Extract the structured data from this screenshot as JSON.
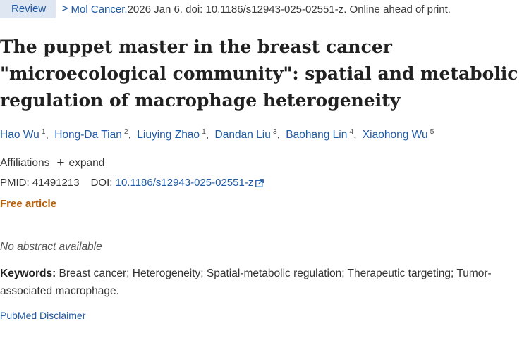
{
  "header": {
    "badge": "Review",
    "chevron": ">",
    "journal": "Mol Cancer.",
    "citation": " 2026 Jan 6. doi: 10.1186/s12943-025-02551-z. Online ahead of print."
  },
  "title_lines": [
    "The puppet master in the breast cancer",
    "\"microecological community\": spatial and metabolic",
    "regulation of macrophage heterogeneity"
  ],
  "authors": [
    {
      "name": "Hao Wu",
      "sup": "1"
    },
    {
      "name": "Hong-Da Tian",
      "sup": "2"
    },
    {
      "name": "Liuying Zhao",
      "sup": "1"
    },
    {
      "name": "Dandan Liu",
      "sup": "3"
    },
    {
      "name": "Baohang Lin",
      "sup": "4"
    },
    {
      "name": "Xiaohong Wu",
      "sup": "5"
    }
  ],
  "affiliations": {
    "label": "Affiliations",
    "expand": "expand"
  },
  "ids": {
    "pmid_label": "PMID:",
    "pmid": "41491213",
    "doi_label": "DOI:",
    "doi": "10.1186/s12943-025-02551-z"
  },
  "free_article": "Free article",
  "no_abstract": "No abstract available",
  "keywords": {
    "label": "Keywords:",
    "text": " Breast cancer; Heterogeneity; Spatial-metabolic regulation; Therapeutic targeting; Tumor-associated macrophage."
  },
  "disclaimer": "PubMed Disclaimer",
  "colors": {
    "link": "#1f5aa6",
    "badge_bg": "#dfe7f2",
    "free_article": "#b8620e"
  }
}
